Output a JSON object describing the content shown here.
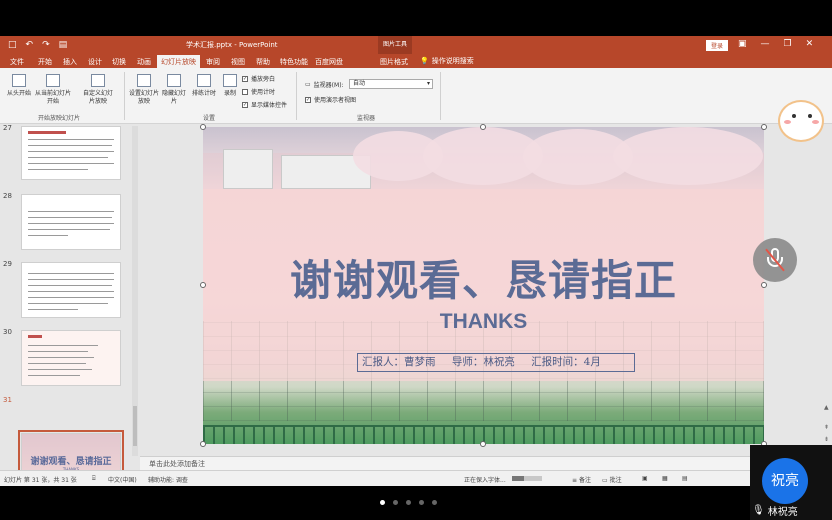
{
  "window": {
    "doc_title": "学术汇报.pptx - PowerPoint",
    "context_tab": "图片工具",
    "login": "登录",
    "qat": [
      "□",
      "↶",
      "↷",
      "▤"
    ],
    "controls": [
      "▣",
      "—",
      "❐",
      "✕"
    ]
  },
  "tabs": [
    "文件",
    "开始",
    "插入",
    "设计",
    "切换",
    "动画",
    "幻灯片放映",
    "审阅",
    "视图",
    "帮助",
    "特色功能",
    "百度网盘",
    "图片格式"
  ],
  "active_tab": "幻灯片放映",
  "tell_me": "操作说明搜索",
  "ribbon": {
    "start_group": {
      "from_start": "从头开始",
      "from_current": "从当前幻灯片开始",
      "custom": "自定义幻灯片放映",
      "label": "开始放映幻灯片"
    },
    "setup_group": {
      "setup": "设置幻灯片放映",
      "hide": "隐藏幻灯片",
      "rehearse": "排练计时",
      "record": "录制",
      "play_narrations": "播放旁白",
      "use_timings": "使用计时",
      "show_media": "显示媒体控件",
      "label": "设置"
    },
    "monitor_group": {
      "monitor_label": "监视器(M):",
      "monitor_value": "自动",
      "presenter_view": "使用演示者视图",
      "label": "监视器"
    }
  },
  "thumbnails": [
    {
      "num": "27"
    },
    {
      "num": "28"
    },
    {
      "num": "29"
    },
    {
      "num": "30"
    },
    {
      "num": "31",
      "title": "谢谢观看、恳请指正",
      "sub": "THANKS"
    }
  ],
  "slide": {
    "title": "谢谢观看、恳请指正",
    "subtitle": "THANKS",
    "reporter": "汇报人：曹梦雨",
    "advisor": "导师：林祝亮",
    "time": "汇报时间：4月"
  },
  "notes_placeholder": "单击此处添加备注",
  "status": {
    "slide_count": "幻灯片 第 31 张，共 31 张",
    "language": "中文(中国)",
    "accessibility": "辅助功能: 调查",
    "saving": "正在保入字体...",
    "save_progress": 0.4,
    "notes": "备注",
    "comments": "批注"
  },
  "meeting": {
    "avatar_text": "祝亮",
    "participant": "林祝亮",
    "pages": 5,
    "current_page": 1
  }
}
